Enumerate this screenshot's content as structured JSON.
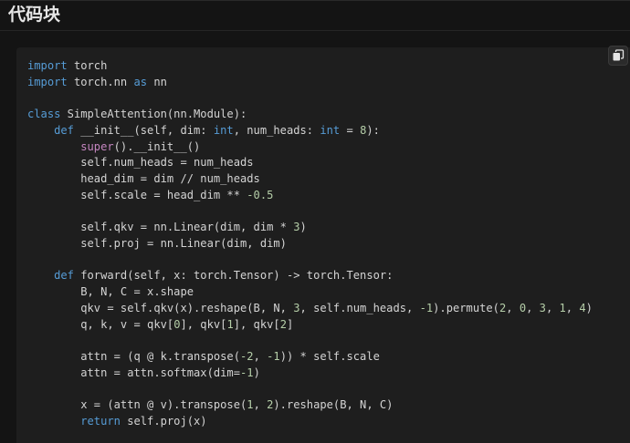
{
  "heading": "代码块",
  "copy_button": {
    "icon": "copy-icon"
  },
  "colors": {
    "background": "#141414",
    "code_background": "#1e1e1e",
    "keyword": "#569cd6",
    "text": "#d4d4d4",
    "number": "#b5cea8",
    "builtin": "#c586c0"
  },
  "code": {
    "language": "python",
    "lines": [
      [
        {
          "t": "kw",
          "v": "import"
        },
        {
          "t": "",
          "v": " torch"
        }
      ],
      [
        {
          "t": "kw",
          "v": "import"
        },
        {
          "t": "",
          "v": " torch.nn "
        },
        {
          "t": "kw",
          "v": "as"
        },
        {
          "t": "",
          "v": " nn"
        }
      ],
      [],
      [
        {
          "t": "kw",
          "v": "class"
        },
        {
          "t": "",
          "v": " SimpleAttention(nn.Module):"
        }
      ],
      [
        {
          "t": "",
          "v": "    "
        },
        {
          "t": "kw",
          "v": "def"
        },
        {
          "t": "",
          "v": " __init__(self, dim: "
        },
        {
          "t": "kw",
          "v": "int"
        },
        {
          "t": "",
          "v": ", num_heads: "
        },
        {
          "t": "kw",
          "v": "int"
        },
        {
          "t": "",
          "v": " = "
        },
        {
          "t": "num",
          "v": "8"
        },
        {
          "t": "",
          "v": "):"
        }
      ],
      [
        {
          "t": "",
          "v": "        "
        },
        {
          "t": "bi",
          "v": "super"
        },
        {
          "t": "",
          "v": "().__init__()"
        }
      ],
      [
        {
          "t": "",
          "v": "        self.num_heads = num_heads"
        }
      ],
      [
        {
          "t": "",
          "v": "        head_dim = dim // num_heads"
        }
      ],
      [
        {
          "t": "",
          "v": "        self.scale = head_dim ** "
        },
        {
          "t": "num",
          "v": "-0.5"
        }
      ],
      [],
      [
        {
          "t": "",
          "v": "        self.qkv = nn.Linear(dim, dim * "
        },
        {
          "t": "num",
          "v": "3"
        },
        {
          "t": "",
          "v": ")"
        }
      ],
      [
        {
          "t": "",
          "v": "        self.proj = nn.Linear(dim, dim)"
        }
      ],
      [],
      [
        {
          "t": "",
          "v": "    "
        },
        {
          "t": "kw",
          "v": "def"
        },
        {
          "t": "",
          "v": " forward(self, x: torch.Tensor) -> torch.Tensor:"
        }
      ],
      [
        {
          "t": "",
          "v": "        B, N, C = x.shape"
        }
      ],
      [
        {
          "t": "",
          "v": "        qkv = self.qkv(x).reshape(B, N, "
        },
        {
          "t": "num",
          "v": "3"
        },
        {
          "t": "",
          "v": ", self.num_heads, "
        },
        {
          "t": "num",
          "v": "-1"
        },
        {
          "t": "",
          "v": ").permute("
        },
        {
          "t": "num",
          "v": "2"
        },
        {
          "t": "",
          "v": ", "
        },
        {
          "t": "num",
          "v": "0"
        },
        {
          "t": "",
          "v": ", "
        },
        {
          "t": "num",
          "v": "3"
        },
        {
          "t": "",
          "v": ", "
        },
        {
          "t": "num",
          "v": "1"
        },
        {
          "t": "",
          "v": ", "
        },
        {
          "t": "num",
          "v": "4"
        },
        {
          "t": "",
          "v": ")"
        }
      ],
      [
        {
          "t": "",
          "v": "        q, k, v = qkv["
        },
        {
          "t": "num",
          "v": "0"
        },
        {
          "t": "",
          "v": "], qkv["
        },
        {
          "t": "num",
          "v": "1"
        },
        {
          "t": "",
          "v": "], qkv["
        },
        {
          "t": "num",
          "v": "2"
        },
        {
          "t": "",
          "v": "]"
        }
      ],
      [],
      [
        {
          "t": "",
          "v": "        attn = (q @ k.transpose("
        },
        {
          "t": "num",
          "v": "-2"
        },
        {
          "t": "",
          "v": ", "
        },
        {
          "t": "num",
          "v": "-1"
        },
        {
          "t": "",
          "v": ")) * self.scale"
        }
      ],
      [
        {
          "t": "",
          "v": "        attn = attn.softmax(dim="
        },
        {
          "t": "num",
          "v": "-1"
        },
        {
          "t": "",
          "v": ")"
        }
      ],
      [],
      [
        {
          "t": "",
          "v": "        x = (attn @ v).transpose("
        },
        {
          "t": "num",
          "v": "1"
        },
        {
          "t": "",
          "v": ", "
        },
        {
          "t": "num",
          "v": "2"
        },
        {
          "t": "",
          "v": ").reshape(B, N, C)"
        }
      ],
      [
        {
          "t": "",
          "v": "        "
        },
        {
          "t": "kw",
          "v": "return"
        },
        {
          "t": "",
          "v": " self.proj(x)"
        }
      ]
    ]
  }
}
